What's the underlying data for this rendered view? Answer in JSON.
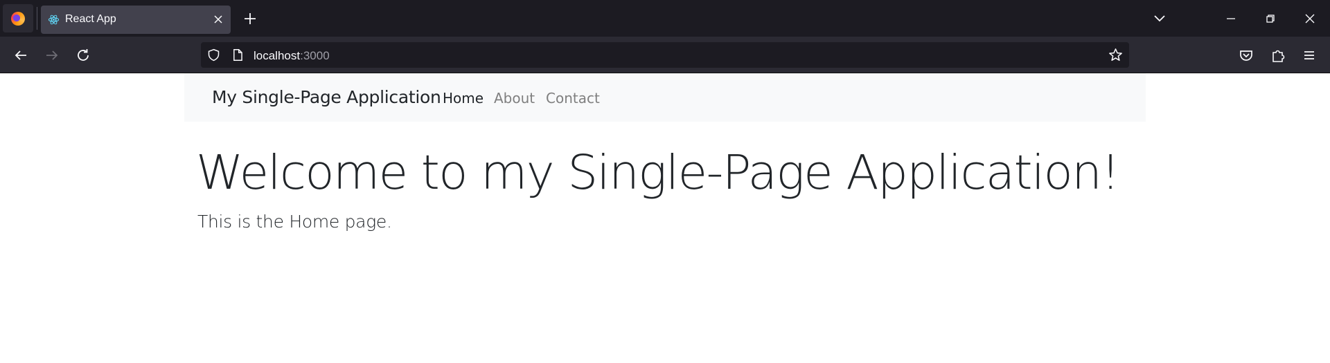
{
  "browser": {
    "tab": {
      "title": "React App",
      "favicon": "react-atom-icon"
    },
    "url": {
      "host": "localhost",
      "port": ":3000"
    },
    "colors": {
      "tabbar": "#1c1b22",
      "toolbar": "#2b2a33",
      "tab_active": "#42414d",
      "urlbar": "#1c1b22"
    }
  },
  "app": {
    "brand": "My Single-Page Application",
    "nav": {
      "home": "Home",
      "about": "About",
      "contact": "Contact"
    },
    "hero": {
      "title": "Welcome to my Single-Page Application!",
      "lead": "This is the Home page."
    },
    "colors": {
      "navbar_bg": "#f8f9fa",
      "text": "#212529",
      "muted_link": "#7f7f7f"
    }
  }
}
